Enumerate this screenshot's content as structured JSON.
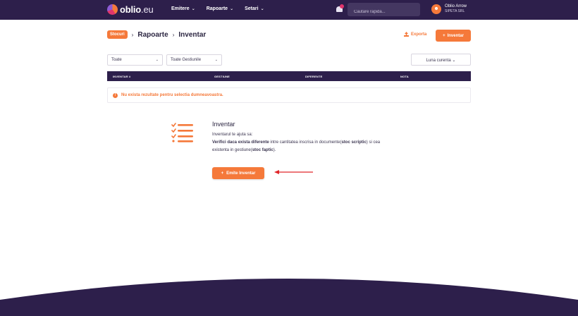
{
  "nav": {
    "logo_main": "oblio",
    "logo_suffix": ".eu",
    "menu": [
      {
        "label": "Emitere"
      },
      {
        "label": "Rapoarte"
      },
      {
        "label": "Setari"
      }
    ],
    "search_placeholder": "Cautare rapida...",
    "user_name": "Oblio Arrow",
    "user_company": "SIPETA SRL"
  },
  "header": {
    "badge": "Stocuri",
    "crumbs": [
      "Rapoarte",
      "Inventar"
    ],
    "export_label": "Exporta",
    "add_label": "Inventar"
  },
  "filters": {
    "type_value": "Toate",
    "gestiune_value": "Toate Gestiunile",
    "period_value": "Luna curenta"
  },
  "table": {
    "columns": [
      "INVENTAR #",
      "GESTIUNE",
      "DIFERENTE",
      "NOTA"
    ],
    "empty_message": "Nu exista rezultate pentru selectia dumneavoastra."
  },
  "info": {
    "title": "Inventar",
    "intro": "Inventarul te ajuta sa:",
    "line1_bold": "Verifici daca exista diferente",
    "line1_rest": " intre cantitatea inscrisa in documente(",
    "line1_bold2": "stoc scriptic",
    "line1_end": ") si cea",
    "line2_start": "existenta in gestiune(",
    "line2_bold": "stoc faptic",
    "line2_end": ").",
    "button_label": "Emite Inventar"
  },
  "colors": {
    "brand_dark": "#2d1f4b",
    "accent": "#f5793a",
    "annotation_arrow": "#e0262a"
  }
}
